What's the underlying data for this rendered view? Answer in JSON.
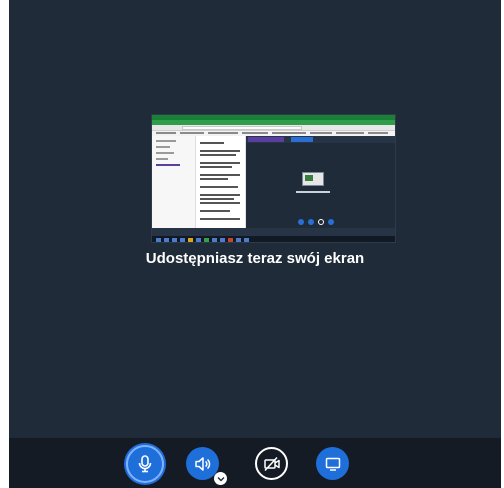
{
  "main": {
    "share_status_text": "Udostępniasz teraz swój ekran"
  },
  "toolbar": {
    "controls": [
      {
        "name": "microphone",
        "icon": "microphone-icon",
        "state": "active"
      },
      {
        "name": "audio",
        "icon": "speaker-icon",
        "state": "active"
      },
      {
        "name": "video",
        "icon": "camera-off-icon",
        "state": "off"
      },
      {
        "name": "screen-share",
        "icon": "monitor-icon",
        "state": "active"
      }
    ]
  },
  "colors": {
    "background": "#1f2b39",
    "toolbar": "#141b24",
    "accent_blue": "#1f6fdb",
    "text": "#ffffff"
  }
}
